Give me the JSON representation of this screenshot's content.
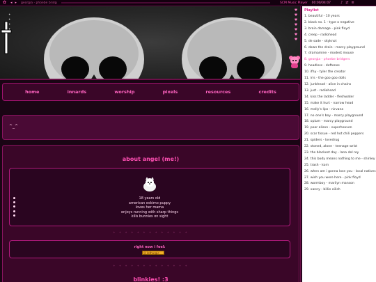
{
  "player": {
    "track_label": "georgia - phoebe bridgers",
    "title": "SCM Music Player",
    "time": "00:00/04:07",
    "progress": 0.0
  },
  "nav": {
    "items": [
      {
        "label": "home"
      },
      {
        "label": "innards"
      },
      {
        "label": "worship"
      },
      {
        "label": "pixels"
      },
      {
        "label": "resources"
      },
      {
        "label": "credits"
      }
    ]
  },
  "status": {
    "emote": "^_^"
  },
  "about": {
    "title": "about angel (me!)",
    "facts": [
      "18 years old",
      "american eskimo puppy",
      "loves her mama",
      "enjoys running with sharp things",
      "kills bunnies on sight"
    ]
  },
  "feel": {
    "label": "right now i feel:",
    "badge": "lethargic"
  },
  "blinkies": {
    "title": "blinkies! :3"
  },
  "playlist": {
    "title": "Playlist",
    "active_index": 7,
    "tracks": [
      "1. beautiful - 10 years",
      "2. black no. 1 - type o negative",
      "3. brain damage - pink floyd",
      "4. creep - radiohead",
      "5. de sade - skyknot",
      "6. down the drain - marcy playground",
      "7. dramamine - modest mouse",
      "8. georgia - phoebe bridgers",
      "9. headless - deftones",
      "10. ifhy - tyler the creator",
      "11. iris - the goo goo dolls",
      "12. junkhead - alice in chains",
      "13. just - radiohead",
      "14. kiss the ladder - fleshwater",
      "15. make it hurt - narrow head",
      "16. molly's lips - nirvana",
      "17. no one's boy - marcy playground",
      "18. opium - marcy playground",
      "19. poor alison - superheaven",
      "20. scar tissue - red hot chili peppers",
      "21. spiders - lovedrug",
      "22. stoned, alone - teenage wrist",
      "23. the blackest day - lana del rey",
      "24. this body means nothing to me - shinley",
      "25. trash - korn",
      "26. when am i gonna lose you - local natives",
      "27. wish you were here - pink floyd",
      "28. wormboy - marilyn manson",
      "29. xanny - billie eilish"
    ]
  },
  "colors": {
    "accent": "#ff4fb3",
    "panel": "#3a0628",
    "border": "#a0136f",
    "background": "#1a0514"
  },
  "icons": {
    "paw": "paw-icon",
    "cross": "cross-icon",
    "bear": "bear-icon",
    "dog": "dog-icon"
  }
}
